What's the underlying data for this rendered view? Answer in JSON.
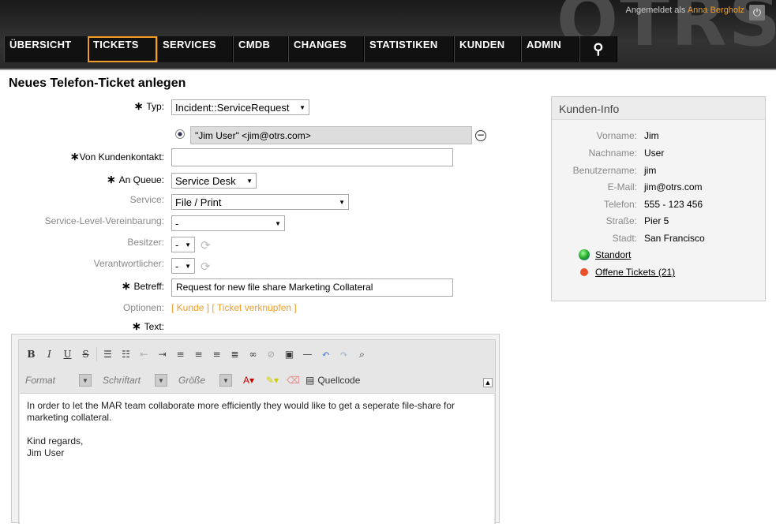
{
  "header": {
    "logo_text": "OTRS",
    "logged_in_as": "Angemeldet als",
    "user_name": "Anna Bergholz"
  },
  "nav": {
    "items": [
      {
        "label": "ÜBERSICHT"
      },
      {
        "label": "TICKETS"
      },
      {
        "label": "SERVICES"
      },
      {
        "label": "CMDB"
      },
      {
        "label": "CHANGES"
      },
      {
        "label": "STATISTIKEN"
      },
      {
        "label": "KUNDEN"
      },
      {
        "label": "ADMIN"
      }
    ],
    "active": "TICKETS"
  },
  "page": {
    "title": "Neues Telefon-Ticket anlegen"
  },
  "form": {
    "typ_label": "Typ:",
    "typ_value": "Incident::ServiceRequest",
    "customer_chip": "\"Jim User\" <jim@otrs.com>",
    "von_label": "Von Kundenkontakt:",
    "von_value": "",
    "queue_label": "An Queue:",
    "queue_value": "Service Desk",
    "service_label": "Service:",
    "service_value": "File / Print",
    "sla_label": "Service-Level-Vereinbarung:",
    "sla_value": "-",
    "owner_label": "Besitzer:",
    "owner_value": "-",
    "resp_label": "Verantwortlicher:",
    "resp_value": "-",
    "subject_label": "Betreff:",
    "subject_value": "Request for new file share Marketing Collateral",
    "options_label": "Optionen:",
    "options_links": "[ Kunde ] [ Ticket verknüpfen ]",
    "text_label": "Text:"
  },
  "editor": {
    "format_placeholder": "Format",
    "font_placeholder": "Schriftart",
    "size_placeholder": "Größe",
    "source_label": "Quellcode",
    "body_line1": "In order to let the MAR team collaborate more efficiently they would like to get a seperate file-share for",
    "body_line2": "marketing collateral.",
    "body_line3": "Kind regards,",
    "body_line4": "Jim User"
  },
  "customer_info": {
    "title": "Kunden-Info",
    "rows": [
      {
        "key": "Vorname:",
        "value": "Jim"
      },
      {
        "key": "Nachname:",
        "value": "User"
      },
      {
        "key": "Benutzername:",
        "value": "jim"
      },
      {
        "key": "E-Mail:",
        "value": "jim@otrs.com"
      },
      {
        "key": "Telefon:",
        "value": "555 - 123 456"
      },
      {
        "key": "Straße:",
        "value": "Pier 5"
      },
      {
        "key": "Stadt:",
        "value": "San Francisco"
      }
    ],
    "link_location": "Standort",
    "link_open_tickets": "Offene Tickets (21)"
  },
  "colors": {
    "accent": "#f29e26",
    "header_bg": "#2a2a2a"
  }
}
